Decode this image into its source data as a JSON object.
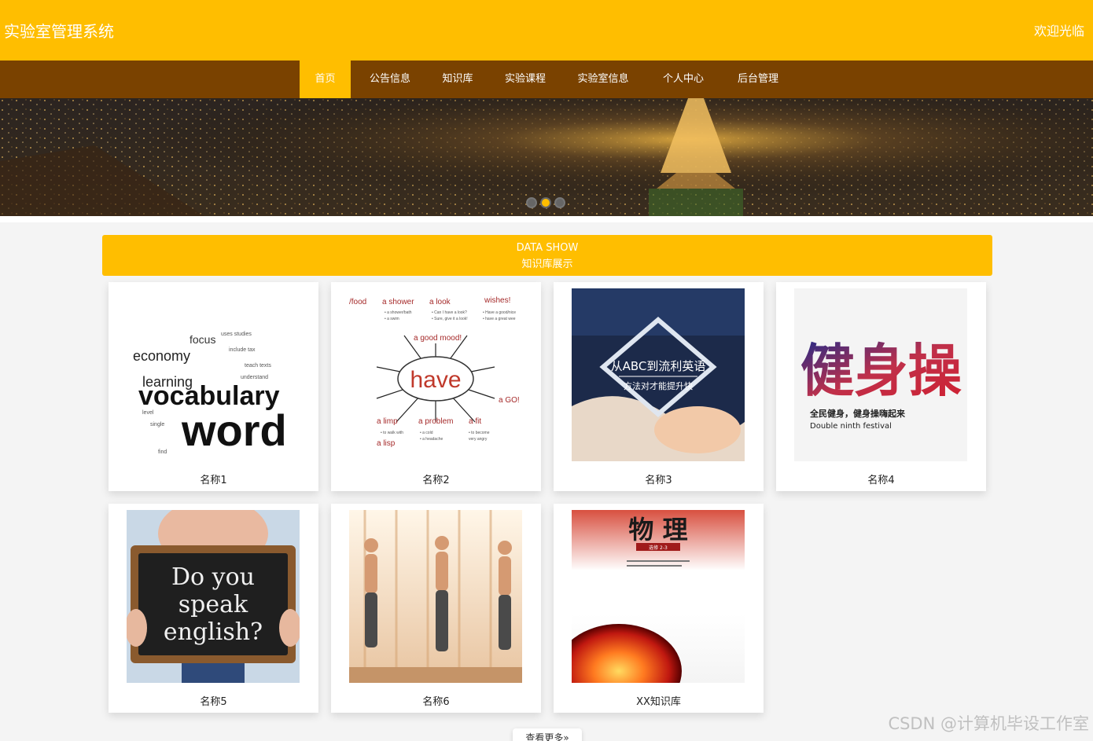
{
  "header": {
    "title": "实验室管理系统",
    "welcome": "欢迎光临"
  },
  "nav": {
    "items": [
      {
        "label": "首页",
        "active": true
      },
      {
        "label": "公告信息"
      },
      {
        "label": "知识库"
      },
      {
        "label": "实验课程"
      },
      {
        "label": "实验室信息"
      },
      {
        "label": "个人中心"
      },
      {
        "label": "后台管理"
      }
    ]
  },
  "banner": {
    "active_dot": 1,
    "dot_count": 3
  },
  "section": {
    "title_en": "DATA SHOW",
    "title_cn": "知识库展示"
  },
  "cards": [
    {
      "name": "名称1"
    },
    {
      "name": "名称2"
    },
    {
      "name": "名称3"
    },
    {
      "name": "名称4"
    },
    {
      "name": "名称5"
    },
    {
      "name": "名称6"
    },
    {
      "name": "XX知识库"
    }
  ],
  "thumb_text": {
    "card1": {
      "w1": "vocabulary",
      "w2": "word",
      "w3": "learning",
      "w4": "economy",
      "w5": "focus"
    },
    "card2": {
      "center": "have",
      "c1": "a shower",
      "c2": "a look",
      "c3": "wishes!",
      "c4": "a good mood!",
      "c5": "a limp",
      "c6": "a problem",
      "c7": "a fit",
      "c8": "a lisp",
      "c9": "a GO!",
      "c10": "/food"
    },
    "card3": {
      "line1": "从ABC到流利英语",
      "line2": "方法对才能提升快"
    },
    "card4": {
      "big": "健身操",
      "line1": "全民健身，健身操嗨起来",
      "line2": "Double ninth festival"
    },
    "card5": {
      "l1": "Do you",
      "l2": "speak",
      "l3": "english?"
    },
    "card7": {
      "title": "物 理",
      "sub": "选修 2-3"
    }
  },
  "more": {
    "label": "查看更多»"
  },
  "watermark": "CSDN @计算机毕设工作室",
  "colors": {
    "accent": "#ffbe00",
    "nav_bg": "#7a4200",
    "page_bg": "#f4f4f4"
  }
}
